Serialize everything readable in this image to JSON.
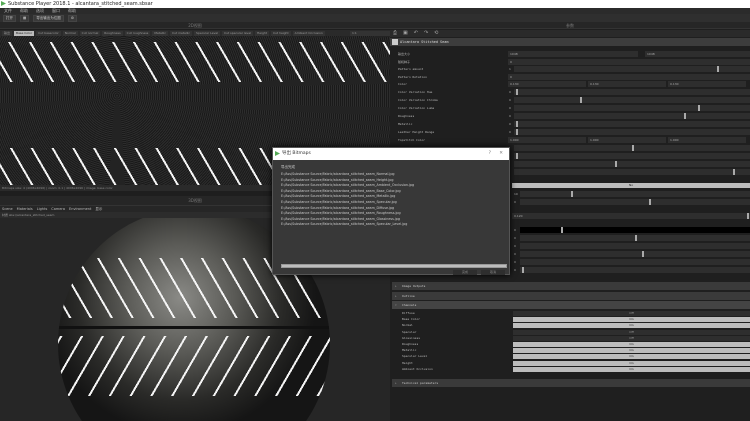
{
  "window": {
    "title": "Substance Player 2018.1 - alcantara_stitched_seam.sbsar"
  },
  "menu": [
    "文件",
    "帮助",
    "选项",
    "窗口",
    "帮助"
  ],
  "toolbar": {
    "open": "打开",
    "export": "导出输出为位图"
  },
  "view2d": {
    "title": "2D视图",
    "tabs_label": "输出",
    "tabs": [
      "Base Color",
      "Cut basecolor",
      "Normal",
      "Cut normal",
      "Roughness",
      "Cut roughness",
      "Metallic",
      "Cut metallic",
      "Specular Level",
      "Cut specular level",
      "Height",
      "Cut height",
      "Ambient Occlusion"
    ],
    "zoom": "1:1",
    "status": "Bitmaps size: 4 (4096x4096) | zoom: 0.1 | 4096x4096 | image: base color"
  },
  "view3d": {
    "title": "3D视图",
    "menu": [
      "Scene",
      "Materials",
      "Lights",
      "Camera",
      "Environment",
      "显示"
    ],
    "path_label": "材质",
    "path": "sbs://alcantara_stitched_seam"
  },
  "right": {
    "header": "参数",
    "graph_title": "Alcantara Stitched Seam",
    "params": [
      {
        "label": "输出大小",
        "value": "1048",
        "value2": "1048"
      },
      {
        "label": "随机种子",
        "value": "0"
      },
      {
        "label": "Pattern amount",
        "value": "1",
        "pos": 0.86
      },
      {
        "label": "Pattern Rotation",
        "value": "0"
      },
      {
        "label": "Color",
        "value": "0.130",
        "value2": "0.130",
        "value3": "0.130"
      },
      {
        "label": "Color Variation Hue",
        "value": "0",
        "pos": 0.01
      },
      {
        "label": "Color Variation Chroma",
        "value": "0",
        "pos": 0.28
      },
      {
        "label": "Color Variation Luma",
        "value": "0",
        "pos": 0.78
      },
      {
        "label": "Roughness",
        "value": "0",
        "pos": 0.72
      },
      {
        "label": "Metallic",
        "value": "0",
        "pos": 0.01
      },
      {
        "label": "Leather Height Range",
        "value": "0",
        "pos": 0.01
      },
      {
        "label": "Topstitch Color",
        "value": "1.000",
        "value2": "1.000",
        "value3": "1.000"
      }
    ],
    "extra_sliders": [
      0.5,
      0.01,
      0.43,
      0.93
    ],
    "toggle_label": "No",
    "extra2": [
      {
        "value": "10",
        "pos": 0.22
      },
      {
        "value": "0",
        "pos": 0.56
      }
    ],
    "wide_value": "0.120",
    "extra3": [
      {
        "value": "0",
        "pos": 0.18
      },
      {
        "value": "0",
        "pos": 0.5
      },
      {
        "value": "0",
        "pos": null
      },
      {
        "value": "0",
        "pos": 0.53
      },
      {
        "value": "0",
        "pos": null
      },
      {
        "value": "0",
        "pos": 0.01
      }
    ],
    "groups": [
      "Image Outputs",
      "Outline",
      "Channels",
      "Technical parameters"
    ],
    "channels": [
      {
        "label": "Diffuse",
        "value": "Off"
      },
      {
        "label": "Base Color",
        "value": "On"
      },
      {
        "label": "Normal",
        "value": "On"
      },
      {
        "label": "Specular",
        "value": "Off"
      },
      {
        "label": "Glossiness",
        "value": "Off"
      },
      {
        "label": "Roughness",
        "value": "On"
      },
      {
        "label": "Metallic",
        "value": "On"
      },
      {
        "label": "Specular Level",
        "value": "On"
      },
      {
        "label": "Height",
        "value": "On"
      },
      {
        "label": "Ambient Occlusion",
        "value": "On"
      }
    ]
  },
  "dialog": {
    "title": "导出 Bitmaps",
    "status": "导出完成",
    "files": [
      "E:/Ass/Substance Source/Fabric/alcantara_stitched_seam_Normal.jpg",
      "E:/Ass/Substance Source/Fabric/alcantara_stitched_seam_Height.jpg",
      "E:/Ass/Substance Source/Fabric/alcantara_stitched_seam_Ambient_Occlusion.jpg",
      "E:/Ass/Substance Source/Fabric/alcantara_stitched_seam_Base_Color.jpg",
      "E:/Ass/Substance Source/Fabric/alcantara_stitched_seam_Metallic.jpg",
      "E:/Ass/Substance Source/Fabric/alcantara_stitched_seam_Specular.jpg",
      "E:/Ass/Substance Source/Fabric/alcantara_stitched_seam_Diffuse.jpg",
      "E:/Ass/Substance Source/Fabric/alcantara_stitched_seam_Roughness.jpg",
      "E:/Ass/Substance Source/Fabric/alcantara_stitched_seam_Glossiness.jpg",
      "E:/Ass/Substance Source/Fabric/alcantara_stitched_seam_Specular_Level.jpg"
    ],
    "progress": 1.0,
    "ok": "完成",
    "cancel": "取消"
  }
}
